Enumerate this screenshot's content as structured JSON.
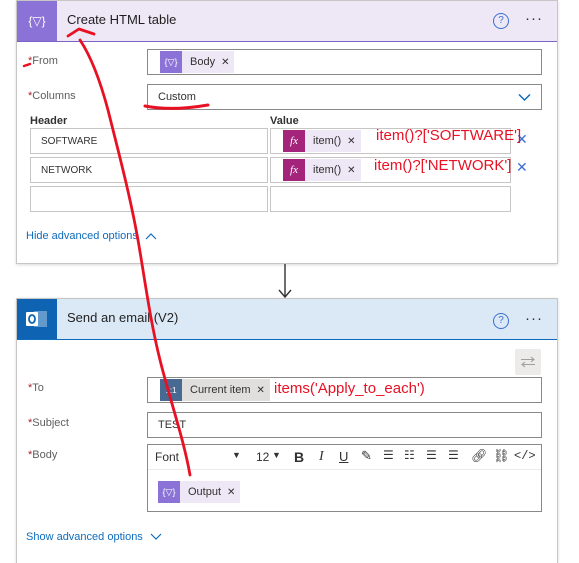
{
  "card1": {
    "title": "Create HTML table",
    "icon": "{▽}",
    "help": "?",
    "more": "···",
    "from": {
      "label": "From",
      "token": "Body",
      "token_icon": "{▽}"
    },
    "columns": {
      "label": "Columns",
      "value": "Custom"
    },
    "table": {
      "header_col": "Header",
      "value_col": "Value",
      "rows": [
        {
          "header": "SOFTWARE",
          "token": "item()",
          "token_icon": "fx"
        },
        {
          "header": "NETWORK",
          "token": "item()",
          "token_icon": "fx"
        }
      ]
    },
    "advanced_link": "Hide advanced options"
  },
  "card2": {
    "title": "Send an email (V2)",
    "help": "?",
    "more": "···",
    "to": {
      "label": "To",
      "token": "Current item",
      "token_icon": "1:1"
    },
    "subject": {
      "label": "Subject",
      "value": "TEST"
    },
    "body": {
      "label": "Body",
      "font": "Font",
      "size": "12",
      "token": "Output",
      "token_icon": "{▽}"
    },
    "advanced_link": "Show advanced options"
  },
  "annotations": {
    "software_expr": "item()?['SOFTWARE']",
    "network_expr": "item()?['NETWORK']",
    "to_expr": "items('Apply_to_each')"
  },
  "colors": {
    "table_accent": "#8b72d6",
    "email_accent": "#0e64b2",
    "fx_token": "#a4247c",
    "annotation_red": "#e81123",
    "link_blue": "#0f6cbd"
  }
}
